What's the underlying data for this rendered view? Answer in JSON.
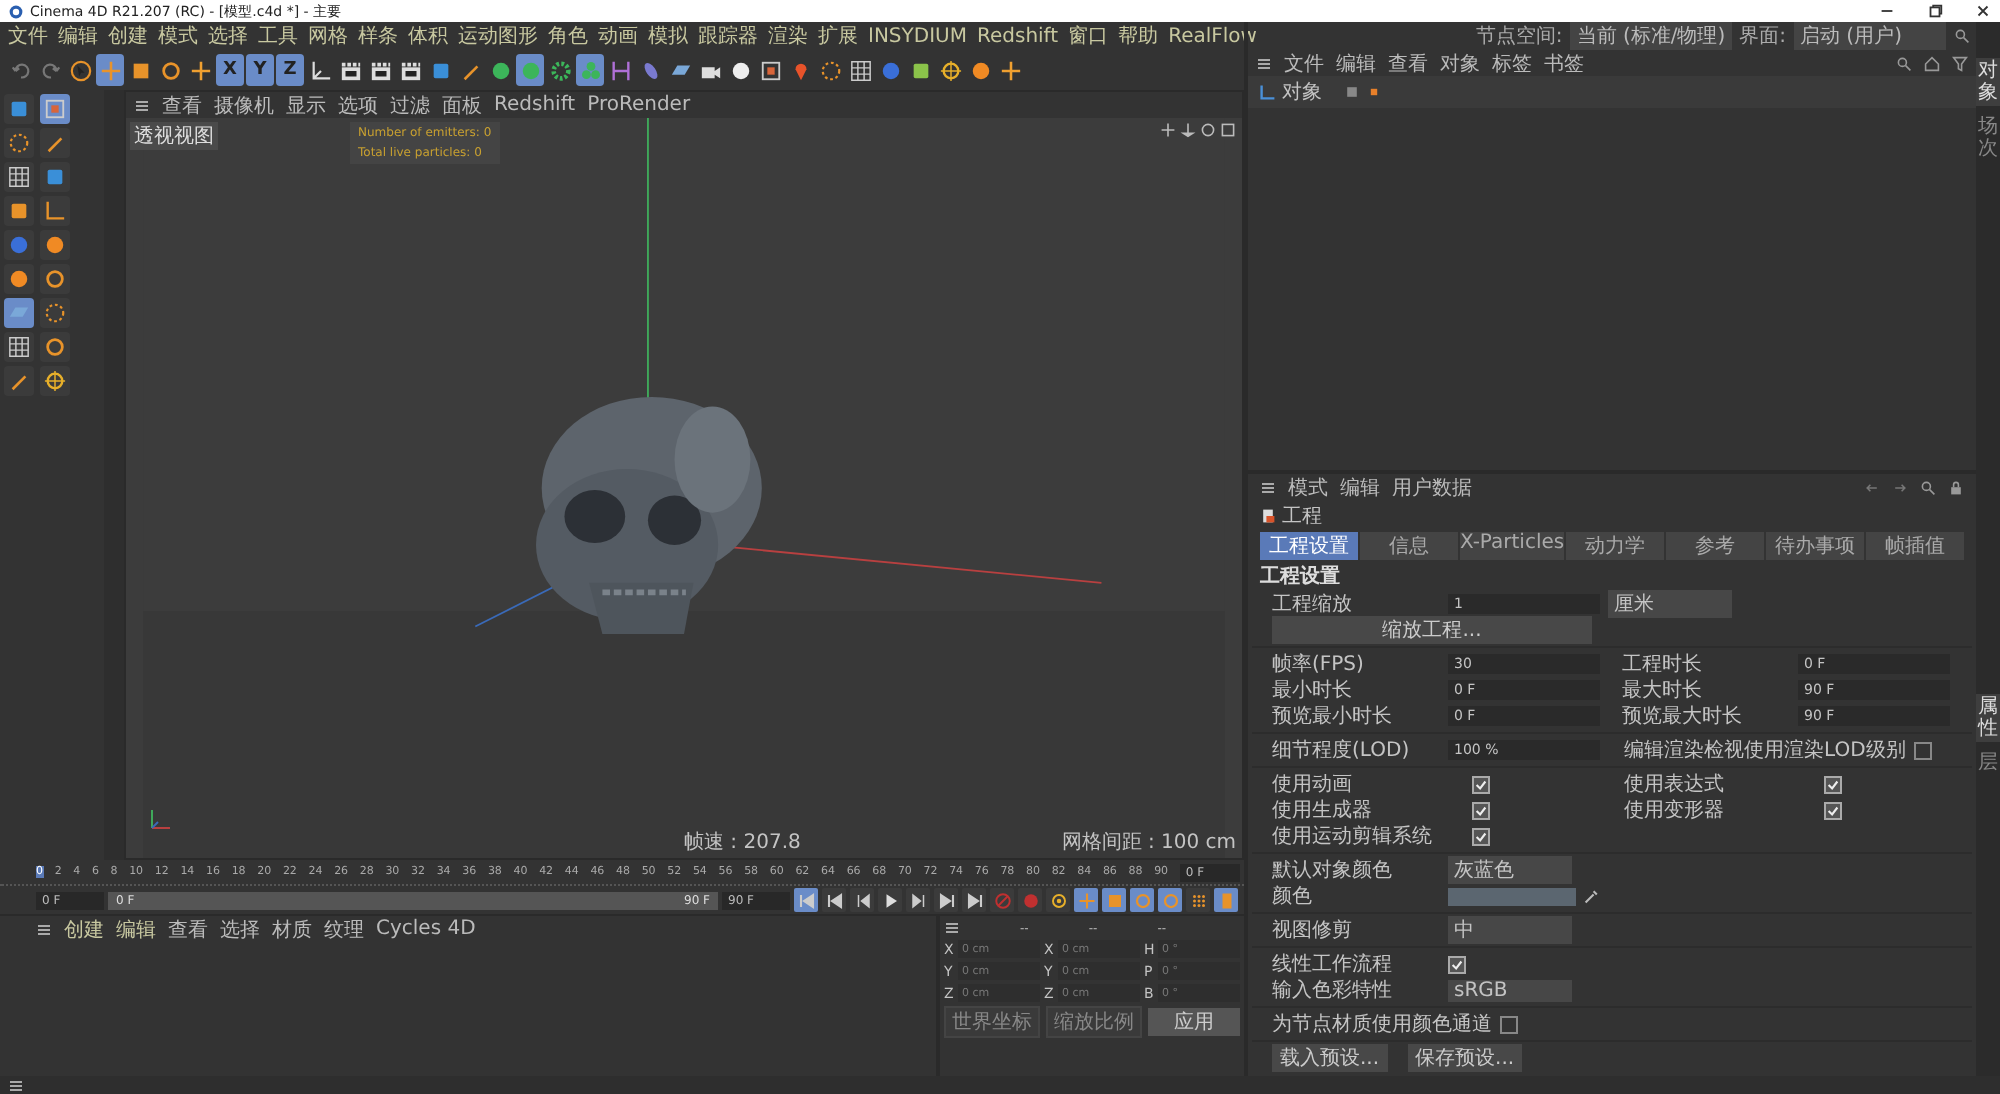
{
  "window": {
    "title": "Cinema 4D R21.207 (RC) - [模型.c4d *] - 主要"
  },
  "menu": [
    "文件",
    "编辑",
    "创建",
    "模式",
    "选择",
    "工具",
    "网格",
    "样条",
    "体积",
    "运动图形",
    "角色",
    "动画",
    "模拟",
    "跟踪器",
    "渲染",
    "扩展",
    "INSYDIUM",
    "Redshift",
    "窗口",
    "帮助",
    "RealFlow"
  ],
  "layout_bar": {
    "node_space_label": "节点空间:",
    "node_space_value": "当前 (标准/物理)",
    "interface_label": "界面:",
    "interface_value": "启动 (用户)"
  },
  "toolbar": {
    "tools": [
      {
        "kind": "undo",
        "selected": false
      },
      {
        "kind": "redo",
        "selected": false
      },
      {
        "kind": "select",
        "selected": false
      },
      {
        "kind": "move",
        "selected": true
      },
      {
        "kind": "scale",
        "selected": false
      },
      {
        "kind": "rotate",
        "selected": false
      },
      {
        "kind": "emitter",
        "selected": false
      }
    ],
    "axes": [
      {
        "label": "X",
        "selected": true
      },
      {
        "label": "Y",
        "selected": true
      },
      {
        "label": "Z",
        "selected": true
      }
    ],
    "objects": [
      {
        "kind": "coord",
        "selected": false
      },
      {
        "kind": "clap",
        "selected": false
      },
      {
        "kind": "clap",
        "selected": false
      },
      {
        "kind": "clap",
        "selected": false
      },
      {
        "kind": "cube",
        "selected": false
      },
      {
        "kind": "pen",
        "selected": false
      },
      {
        "kind": "green",
        "selected": false
      },
      {
        "kind": "green",
        "selected": true
      },
      {
        "kind": "gear",
        "selected": false
      },
      {
        "kind": "cluster",
        "selected": true
      },
      {
        "kind": "bracket",
        "selected": false
      },
      {
        "kind": "capsule",
        "selected": false
      },
      {
        "kind": "floor",
        "selected": false
      },
      {
        "kind": "camera",
        "selected": false
      },
      {
        "kind": "light",
        "selected": false
      },
      {
        "kind": "frame",
        "selected": false
      },
      {
        "kind": "pin",
        "selected": false
      },
      {
        "kind": "dashed",
        "selected": false
      },
      {
        "kind": "grid",
        "selected": false
      },
      {
        "kind": "badge",
        "selected": false
      },
      {
        "kind": "plug",
        "selected": false
      },
      {
        "kind": "target",
        "selected": false
      },
      {
        "kind": "s",
        "selected": false
      },
      {
        "kind": "emitter",
        "selected": false
      }
    ]
  },
  "left_tools": [
    {
      "kind": "cube",
      "selected": false
    },
    {
      "kind": "frame",
      "selected": true
    },
    {
      "kind": "dashed",
      "selected": false
    },
    {
      "kind": "pen",
      "selected": false
    },
    {
      "kind": "grid",
      "selected": false
    },
    {
      "kind": "cube",
      "selected": false
    },
    {
      "kind": "scale",
      "selected": false
    },
    {
      "kind": "axes",
      "selected": false
    },
    {
      "kind": "badge",
      "selected": false
    },
    {
      "kind": "s",
      "selected": false
    },
    {
      "kind": "s",
      "selected": false
    },
    {
      "kind": "rotate",
      "selected": false
    },
    {
      "kind": "floor",
      "selected": true
    },
    {
      "kind": "dashed",
      "selected": false
    },
    {
      "kind": "grid",
      "selected": false
    },
    {
      "kind": "rotate",
      "selected": false
    },
    {
      "kind": "pen",
      "selected": false
    },
    {
      "kind": "target",
      "selected": false
    }
  ],
  "viewport": {
    "menu": [
      "查看",
      "摄像机",
      "显示",
      "选项",
      "过滤",
      "面板",
      "Redshift",
      "ProRender"
    ],
    "label": "透视视图",
    "hud": [
      "Number of emitters: 0",
      "Total live particles: 0"
    ],
    "fps": "帧速 : 207.8",
    "grid_spacing": "网格间距 : 100 cm"
  },
  "timeline": {
    "ticks": [
      {
        "label": "0",
        "selected": true
      },
      {
        "label": "2",
        "selected": false
      },
      {
        "label": "4",
        "selected": false
      },
      {
        "label": "6",
        "selected": false
      },
      {
        "label": "8",
        "selected": false
      },
      {
        "label": "10",
        "selected": false
      },
      {
        "label": "12",
        "selected": false
      },
      {
        "label": "14",
        "selected": false
      },
      {
        "label": "16",
        "selected": false
      },
      {
        "label": "18",
        "selected": false
      },
      {
        "label": "20",
        "selected": false
      },
      {
        "label": "22",
        "selected": false
      },
      {
        "label": "24",
        "selected": false
      },
      {
        "label": "26",
        "selected": false
      },
      {
        "label": "28",
        "selected": false
      },
      {
        "label": "30",
        "selected": false
      },
      {
        "label": "32",
        "selected": false
      },
      {
        "label": "34",
        "selected": false
      },
      {
        "label": "36",
        "selected": false
      },
      {
        "label": "38",
        "selected": false
      },
      {
        "label": "40",
        "selected": false
      },
      {
        "label": "42",
        "selected": false
      },
      {
        "label": "44",
        "selected": false
      },
      {
        "label": "46",
        "selected": false
      },
      {
        "label": "48",
        "selected": false
      },
      {
        "label": "50",
        "selected": false
      },
      {
        "label": "52",
        "selected": false
      },
      {
        "label": "54",
        "selected": false
      },
      {
        "label": "56",
        "selected": false
      },
      {
        "label": "58",
        "selected": false
      },
      {
        "label": "60",
        "selected": false
      },
      {
        "label": "62",
        "selected": false
      },
      {
        "label": "64",
        "selected": false
      },
      {
        "label": "66",
        "selected": false
      },
      {
        "label": "68",
        "selected": false
      },
      {
        "label": "70",
        "selected": false
      },
      {
        "label": "72",
        "selected": false
      },
      {
        "label": "74",
        "selected": false
      },
      {
        "label": "76",
        "selected": false
      },
      {
        "label": "78",
        "selected": false
      },
      {
        "label": "80",
        "selected": false
      },
      {
        "label": "82",
        "selected": false
      },
      {
        "label": "84",
        "selected": false
      },
      {
        "label": "86",
        "selected": false
      },
      {
        "label": "88",
        "selected": false
      },
      {
        "label": "90",
        "selected": false
      }
    ],
    "current": "0 F",
    "start": "0 F",
    "range_start": "0 F",
    "range_end": "90 F",
    "end": "90 F"
  },
  "playback": [
    {
      "kind": "first",
      "selected": true
    },
    {
      "kind": "first",
      "selected": false
    },
    {
      "kind": "prev",
      "selected": false
    },
    {
      "kind": "play",
      "selected": false
    },
    {
      "kind": "next",
      "selected": false
    },
    {
      "kind": "last",
      "selected": false
    },
    {
      "kind": "last",
      "selected": false
    },
    {
      "kind": "record",
      "selected": false
    },
    {
      "kind": "autokey",
      "selected": false
    },
    {
      "kind": "target",
      "selected": false
    },
    {
      "kind": "move",
      "selected": true
    },
    {
      "kind": "scale",
      "selected": true
    },
    {
      "kind": "rotate",
      "selected": true
    },
    {
      "kind": "param",
      "selected": true
    },
    {
      "kind": "dots",
      "selected": false
    },
    {
      "kind": "film",
      "selected": true
    }
  ],
  "materials": {
    "menu": [
      "创建",
      "编辑",
      "查看",
      "选择",
      "材质",
      "纹理",
      "Cycles 4D"
    ]
  },
  "coordinates": {
    "headers": [
      "--",
      "--",
      "--"
    ],
    "columns": [
      [
        {
          "axis": "X",
          "placeholder": "0 cm"
        },
        {
          "axis": "Y",
          "placeholder": "0 cm"
        },
        {
          "axis": "Z",
          "placeholder": "0 cm"
        }
      ],
      [
        {
          "axis": "X",
          "placeholder": "0 cm"
        },
        {
          "axis": "Y",
          "placeholder": "0 cm"
        },
        {
          "axis": "Z",
          "placeholder": "0 cm"
        }
      ],
      [
        {
          "axis": "H",
          "placeholder": "0 °"
        },
        {
          "axis": "P",
          "placeholder": "0 °"
        },
        {
          "axis": "B",
          "placeholder": "0 °"
        }
      ]
    ],
    "space": "世界坐标",
    "scale_mode": "缩放比例",
    "apply": "应用"
  },
  "object_manager": {
    "menu": [
      "文件",
      "编辑",
      "查看",
      "对象",
      "标签",
      "书签"
    ],
    "objects": [
      {
        "name": "对象"
      }
    ]
  },
  "side_tabs_top": [
    {
      "label": "对象",
      "selected": true
    },
    {
      "label": "场次",
      "selected": false
    }
  ],
  "side_tabs_bottom": [
    {
      "label": "属性",
      "selected": true
    },
    {
      "label": "层",
      "selected": false
    }
  ],
  "attributes": {
    "menu": [
      "模式",
      "编辑",
      "用户数据"
    ],
    "title": "工程",
    "tabs": [
      {
        "label": "工程设置",
        "selected": true
      },
      {
        "label": "信息",
        "selected": false
      },
      {
        "label": "X-Particles",
        "selected": false
      },
      {
        "label": "动力学",
        "selected": false
      },
      {
        "label": "参考",
        "selected": false
      },
      {
        "label": "待办事项",
        "selected": false
      },
      {
        "label": "帧插值",
        "selected": false
      }
    ],
    "section": "工程设置",
    "scale": {
      "label": "工程缩放",
      "value": "1",
      "unit": "厘米"
    },
    "scale_button": "缩放工程...",
    "time_rows": [
      {
        "label": "帧率(FPS)",
        "value": "30",
        "label2": "工程时长",
        "value2": "0 F"
      },
      {
        "label": "最小时长",
        "value": "0 F",
        "label2": "最大时长",
        "value2": "90 F"
      },
      {
        "label": "预览最小时长",
        "value": "0 F",
        "label2": "预览最大时长",
        "value2": "90 F"
      }
    ],
    "lod": {
      "label": "细节程度(LOD)",
      "value": "100 %",
      "check_label": "编辑渲染检视使用渲染LOD级别",
      "checked": false
    },
    "checks": [
      {
        "label": "使用动画",
        "checked": true
      },
      {
        "label": "使用表达式",
        "checked": true
      },
      {
        "label": "使用生成器",
        "checked": true
      },
      {
        "label": "使用变形器",
        "checked": true
      },
      {
        "label": "使用运动剪辑系统",
        "checked": true
      }
    ],
    "object_color": {
      "label": "默认对象颜色",
      "value": "灰蓝色"
    },
    "color_label": "颜色",
    "view_clip": {
      "label": "视图修剪",
      "value": "中"
    },
    "linear": {
      "label": "线性工作流程",
      "checked": true
    },
    "input_color": {
      "label": "输入色彩特性",
      "value": "sRGB"
    },
    "node_color": {
      "label": "为节点材质使用颜色通道",
      "checked": false
    },
    "buttons": [
      "载入预设...",
      "保存预设..."
    ]
  }
}
